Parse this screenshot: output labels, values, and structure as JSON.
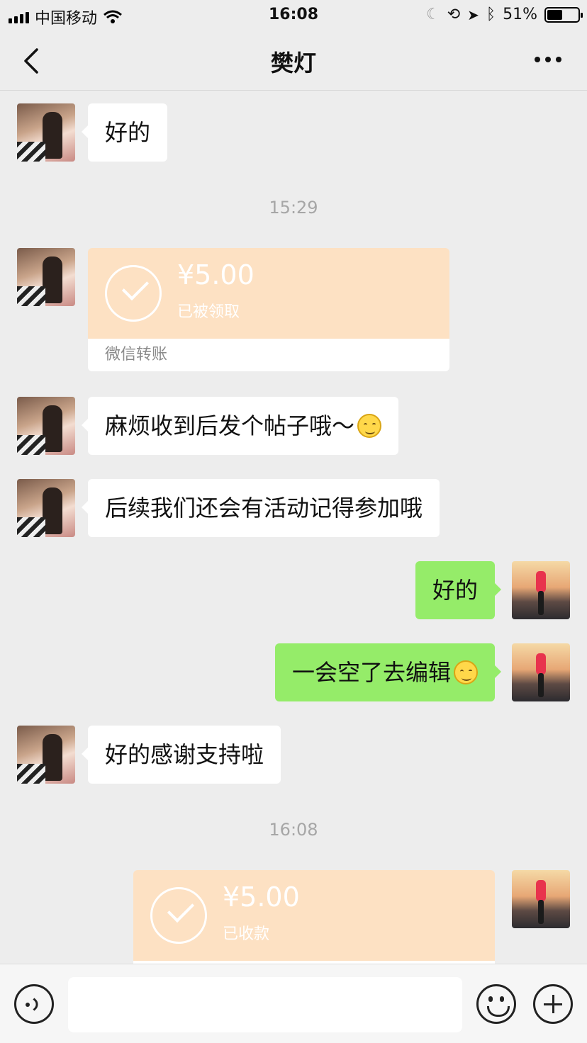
{
  "status_bar": {
    "carrier": "中国移动",
    "time": "16:08",
    "battery": "51%",
    "battery_level": 0.51
  },
  "header": {
    "title": "樊灯",
    "icons": {
      "back": "chevron-left-icon",
      "more": "more-dots-icon"
    }
  },
  "messages": {
    "m1": {
      "text": "好的"
    },
    "t1": {
      "time": "15:29"
    },
    "tr1": {
      "amount": "¥5.00",
      "status": "已被领取",
      "footer": "微信转账"
    },
    "m3": {
      "text": "麻烦收到后发个帖子哦～"
    },
    "m4": {
      "text": "后续我们还会有活动记得参加哦"
    },
    "m5": {
      "text": "好的"
    },
    "m6": {
      "text": "一会空了去编辑"
    },
    "m7": {
      "text": "好的感谢支持啦"
    },
    "t2": {
      "time": "16:08"
    },
    "tr2": {
      "amount": "¥5.00",
      "status": "已收款"
    }
  },
  "input_bar": {
    "icons": {
      "voice": "voice-icon",
      "emoji": "emoji-icon",
      "plus": "plus-icon"
    }
  },
  "colors": {
    "background": "#ededed",
    "incoming_bubble": "#ffffff",
    "outgoing_bubble": "#95ec69",
    "transfer": "#fde1c3"
  }
}
